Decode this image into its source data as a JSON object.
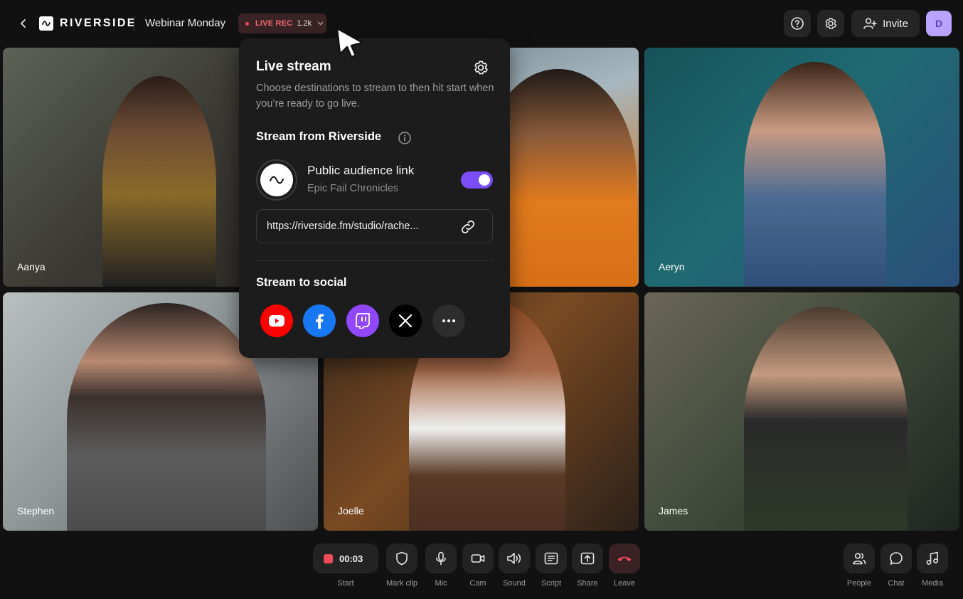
{
  "header": {
    "brand": "RIVERSIDE",
    "session_title": "Webinar Monday",
    "live_badge": {
      "label": "LIVE REC",
      "count": "1.2k"
    },
    "invite_label": "Invite",
    "avatar_initial": "D"
  },
  "participants": [
    {
      "name": "Aanya"
    },
    {
      "name": ""
    },
    {
      "name": "Aeryn"
    },
    {
      "name": "Stephen"
    },
    {
      "name": "Joelle"
    },
    {
      "name": "James"
    }
  ],
  "live_stream_panel": {
    "title": "Live stream",
    "description": "Choose destinations to stream to then hit start when you’re ready to go live.",
    "stream_from_heading": "Stream from Riverside",
    "public_link": {
      "title": "Public audience link",
      "subtitle": "Epic Fail Chronicles",
      "enabled": true,
      "url": "https://riverside.fm/studio/rache..."
    },
    "stream_to_social_heading": "Stream to social",
    "social_icons": [
      "youtube-icon",
      "facebook-icon",
      "twitch-icon",
      "x-icon",
      "more-icon"
    ]
  },
  "controls": {
    "timer": "00:03",
    "start_label": "Start",
    "mark_clip_label": "Mark clip",
    "mic_label": "Mic",
    "cam_label": "Cam",
    "sound_label": "Sound",
    "script_label": "Script",
    "share_label": "Share",
    "leave_label": "Leave",
    "people_label": "People",
    "chat_label": "Chat",
    "media_label": "Media"
  },
  "colors": {
    "accent_purple": "#7a4df5",
    "live_red": "#ef4b57",
    "background": "#111111"
  }
}
